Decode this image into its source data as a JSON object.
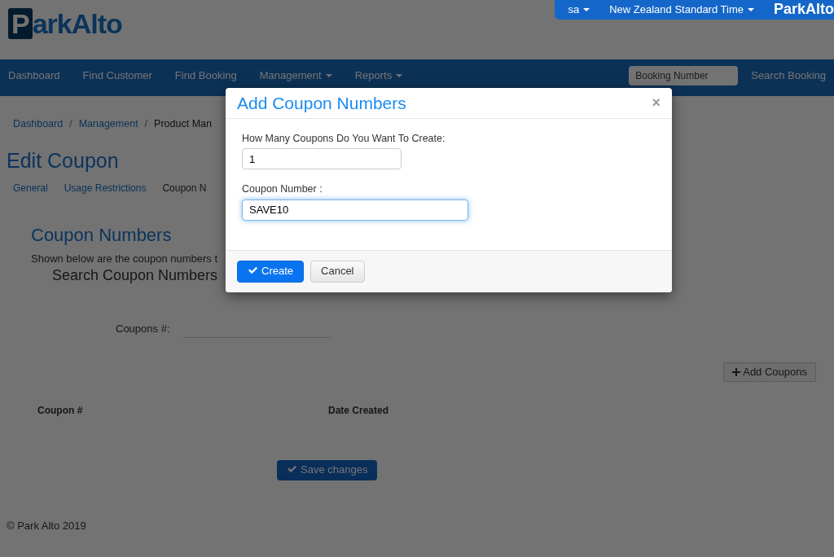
{
  "header": {
    "logo": "ParkAlto",
    "user_menu": "sa",
    "timezone_menu": "New Zealand Standard Time",
    "brand": "ParkAlto"
  },
  "nav": {
    "items": [
      {
        "label": "Dashboard",
        "dropdown": false
      },
      {
        "label": "Find Customer",
        "dropdown": false
      },
      {
        "label": "Find Booking",
        "dropdown": false
      },
      {
        "label": "Management",
        "dropdown": true
      },
      {
        "label": "Reports",
        "dropdown": true
      }
    ],
    "search": {
      "placeholder": "Booking Number"
    },
    "search_button": "Search Booking"
  },
  "breadcrumb": [
    "Dashboard",
    "Management",
    "Product Man"
  ],
  "breadcrumb_separator": "/",
  "page_title": "Edit Coupon",
  "tabs": [
    {
      "label": "General",
      "selected": false
    },
    {
      "label": "Usage Restrictions",
      "selected": false
    },
    {
      "label": "Coupon N",
      "selected": true
    }
  ],
  "section": {
    "title": "Coupon Numbers",
    "description": "Shown below are the coupon numbers t",
    "search_title": "Search Coupon Numbers",
    "search_label": "Coupons #:",
    "add_button": "Add Coupons",
    "columns": [
      "Coupon #",
      "Date Created"
    ],
    "save_button": "Save changes"
  },
  "footer": "© Park Alto 2019",
  "modal": {
    "title": "Add Coupon Numbers",
    "close": "×",
    "fields": [
      {
        "label": "How Many Coupons Do You Want To Create:",
        "value": "1",
        "focused": false,
        "kind": "short"
      },
      {
        "label": "Coupon Number :",
        "value": "SAVE10",
        "focused": true,
        "kind": "long"
      }
    ],
    "buttons": [
      {
        "label": "Create",
        "kind": "primary"
      },
      {
        "label": "Cancel",
        "kind": "secondary"
      }
    ]
  }
}
